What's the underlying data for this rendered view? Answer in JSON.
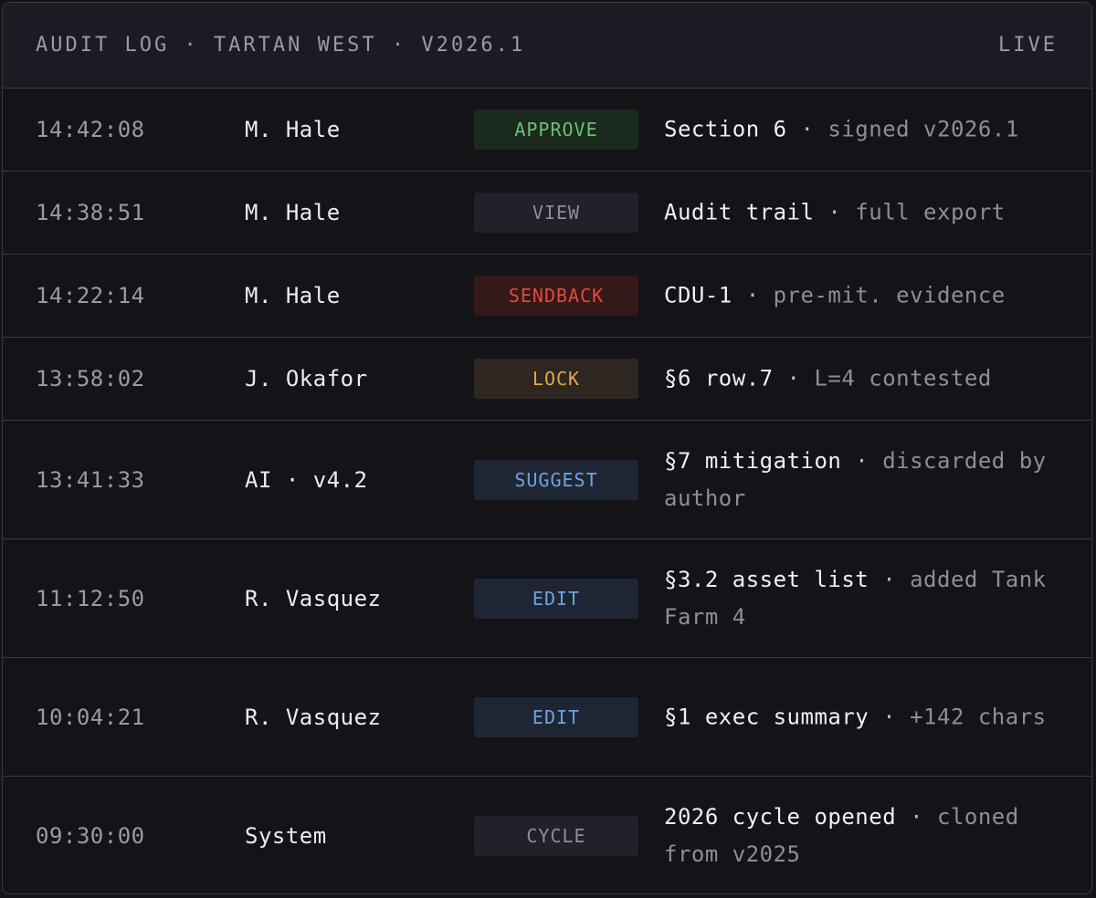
{
  "header": {
    "title": "AUDIT LOG · TARTAN WEST · V2026.1",
    "status": "LIVE"
  },
  "colors": {
    "approve": {
      "text": "#6cc070",
      "bg": "#1b2a1f"
    },
    "view": {
      "text": "#8e8e98",
      "bg": "#20212a"
    },
    "sendback": {
      "text": "#e04a3c",
      "bg": "#35181a"
    },
    "lock": {
      "text": "#e0a84a",
      "bg": "#2e2620"
    },
    "suggest": {
      "text": "#6ea2e0",
      "bg": "#1f2633"
    },
    "edit": {
      "text": "#6ea2e0",
      "bg": "#1f2633"
    },
    "cycle": {
      "text": "#8e8e98",
      "bg": "#20212a"
    }
  },
  "entries": [
    {
      "time": "14:42:08",
      "actor": "M. Hale",
      "action": "APPROVE",
      "kind": "approve",
      "detail_main": "Section 6",
      "sep": " · ",
      "detail_sub": "signed v2026.1",
      "lines": 1
    },
    {
      "time": "14:38:51",
      "actor": "M. Hale",
      "action": "VIEW",
      "kind": "view",
      "detail_main": "Audit trail",
      "sep": " · ",
      "detail_sub": "full export",
      "lines": 1
    },
    {
      "time": "14:22:14",
      "actor": "M. Hale",
      "action": "SENDBACK",
      "kind": "sendback",
      "detail_main": "CDU-1",
      "sep": " · ",
      "detail_sub": "pre-mit. evidence",
      "lines": 1
    },
    {
      "time": "13:58:02",
      "actor": "J. Okafor",
      "action": "LOCK",
      "kind": "lock",
      "detail_main": "§6 row.7",
      "sep": " · ",
      "detail_sub": "L=4 contested",
      "lines": 1
    },
    {
      "time": "13:41:33",
      "actor": "AI · v4.2",
      "action": "SUGGEST",
      "kind": "suggest",
      "detail_main": "§7 mitigation",
      "sep": " · ",
      "detail_sub": "discarded by author",
      "lines": 2
    },
    {
      "time": "11:12:50",
      "actor": "R. Vasquez",
      "action": "EDIT",
      "kind": "edit",
      "detail_main": "§3.2 asset list",
      "sep": " · ",
      "detail_sub": "added Tank Farm 4",
      "lines": 2
    },
    {
      "time": "10:04:21",
      "actor": "R. Vasquez",
      "action": "EDIT",
      "kind": "edit",
      "detail_main": "§1 exec summary",
      "sep": " · ",
      "detail_sub": "+142 chars",
      "lines": 2
    },
    {
      "time": "09:30:00",
      "actor": "System",
      "action": "CYCLE",
      "kind": "cycle",
      "detail_main": "2026 cycle opened",
      "sep": " · ",
      "detail_sub": "cloned from v2025",
      "lines": 2
    }
  ]
}
